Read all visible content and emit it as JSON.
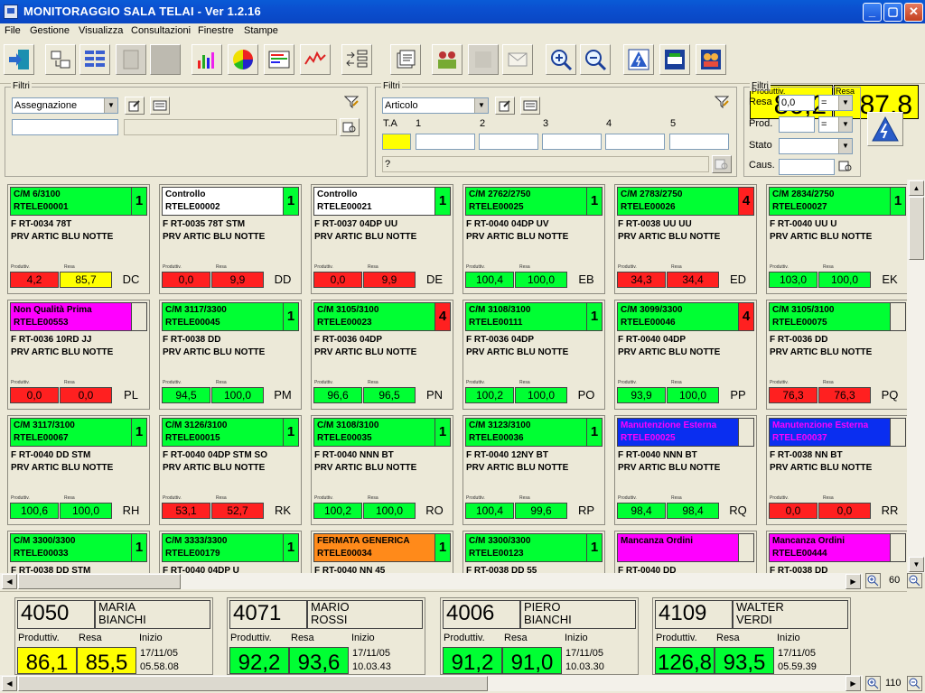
{
  "window": {
    "title": "MONITORAGGIO SALA TELAI - Ver 1.2.16",
    "min": "_",
    "max": "▢",
    "close": "✕"
  },
  "menu": [
    "File",
    "Gestione",
    "Visualizza",
    "Consultazioni",
    "Finestre",
    "Stampe"
  ],
  "kpis": {
    "produttiv_label": "Produttiv.",
    "produttiv_value": "86,2",
    "resa_label": "Resa",
    "resa_value": "87,8"
  },
  "filter1": {
    "label": "Filtri",
    "combo": "Assegnazione"
  },
  "filter2": {
    "label": "Filtri",
    "combo": "Articolo",
    "ta": "T.A",
    "cols": [
      "1",
      "2",
      "3",
      "4",
      "5"
    ],
    "query": "?"
  },
  "filter3": {
    "label": "Filtri",
    "resa_label": "Resa",
    "resa_value": "0,0",
    "resa_op": "=",
    "prod_label": "Prod.",
    "prod_op": "=",
    "stato_label": "Stato",
    "caus_label": "Caus."
  },
  "card_labels": {
    "produttiv": "Produttiv.",
    "resa": "Resa"
  },
  "cards": [
    {
      "h1": "C/M  6/3100",
      "h2": "RTELE00001",
      "num": "1",
      "color": "#00ff33",
      "numcolor": "#00ff33",
      "art": "F RT-0034 78T",
      "col": "PRV ARTIC BLU NOTTE",
      "prod": "4,2",
      "pcolor": "#ff2020",
      "resa": "85,7",
      "rcolor": "#ffff00",
      "code": "DC"
    },
    {
      "h1": "Controllo",
      "h2": "RTELE00002",
      "num": "1",
      "color": "#ffffff",
      "numcolor": "#00ff33",
      "art": "F RT-0035 78T STM",
      "col": "PRV ARTIC BLU NOTTE",
      "prod": "0,0",
      "pcolor": "#ff2020",
      "resa": "9,9",
      "rcolor": "#ff2020",
      "code": "DD"
    },
    {
      "h1": "Controllo",
      "h2": "RTELE00021",
      "num": "1",
      "color": "#ffffff",
      "numcolor": "#00ff33",
      "art": "F RT-0037 04DP UU",
      "col": "PRV ARTIC BLU NOTTE",
      "prod": "0,0",
      "pcolor": "#ff2020",
      "resa": "9,9",
      "rcolor": "#ff2020",
      "code": "DE"
    },
    {
      "h1": "C/M  2762/2750",
      "h2": "RTELE00025",
      "num": "1",
      "color": "#00ff33",
      "numcolor": "#00ff33",
      "art": "F RT-0040 04DP UV",
      "col": "PRV ARTIC BLU NOTTE",
      "prod": "100,4",
      "pcolor": "#00ff33",
      "resa": "100,0",
      "rcolor": "#00ff33",
      "code": "EB"
    },
    {
      "h1": "C/M  2783/2750",
      "h2": "RTELE00026",
      "num": "4",
      "color": "#00ff33",
      "numcolor": "#ff2020",
      "art": "F RT-0038 UU UU",
      "col": "PRV ARTIC BLU NOTTE",
      "prod": "34,3",
      "pcolor": "#ff2020",
      "resa": "34,4",
      "rcolor": "#ff2020",
      "code": "ED"
    },
    {
      "h1": "C/M  2834/2750",
      "h2": "RTELE00027",
      "num": "1",
      "color": "#00ff33",
      "numcolor": "#00ff33",
      "art": "F RT-0040 UU U",
      "col": "PRV ARTIC BLU NOTTE",
      "prod": "103,0",
      "pcolor": "#00ff33",
      "resa": "100,0",
      "rcolor": "#00ff33",
      "code": "EK"
    },
    {
      "h1": "Non Qualità Prima",
      "h2": "RTELE00553",
      "num": "",
      "color": "#ff00ff",
      "numcolor": "#ece9d8",
      "art": "F RT-0036 10RD JJ",
      "col": "PRV ARTIC BLU NOTTE",
      "prod": "0,0",
      "pcolor": "#ff2020",
      "resa": "0,0",
      "rcolor": "#ff2020",
      "code": "PL"
    },
    {
      "h1": "C/M  3117/3300",
      "h2": "RTELE00045",
      "num": "1",
      "color": "#00ff33",
      "numcolor": "#00ff33",
      "art": "F RT-0038 DD",
      "col": "PRV ARTIC BLU NOTTE",
      "prod": "94,5",
      "pcolor": "#00ff33",
      "resa": "100,0",
      "rcolor": "#00ff33",
      "code": "PM"
    },
    {
      "h1": "C/M  3105/3100",
      "h2": "RTELE00023",
      "num": "4",
      "color": "#00ff33",
      "numcolor": "#ff2020",
      "art": "F RT-0036 04DP",
      "col": "PRV ARTIC BLU NOTTE",
      "prod": "96,6",
      "pcolor": "#00ff33",
      "resa": "96,5",
      "rcolor": "#00ff33",
      "code": "PN"
    },
    {
      "h1": "C/M  3108/3100",
      "h2": "RTELE00111",
      "num": "1",
      "color": "#00ff33",
      "numcolor": "#00ff33",
      "art": "F RT-0036 04DP",
      "col": "PRV ARTIC BLU NOTTE",
      "prod": "100,2",
      "pcolor": "#00ff33",
      "resa": "100,0",
      "rcolor": "#00ff33",
      "code": "PO"
    },
    {
      "h1": "C/M  3099/3300",
      "h2": "RTELE00046",
      "num": "4",
      "color": "#00ff33",
      "numcolor": "#ff2020",
      "art": "F RT-0040 04DP",
      "col": "PRV ARTIC BLU NOTTE",
      "prod": "93,9",
      "pcolor": "#00ff33",
      "resa": "100,0",
      "rcolor": "#00ff33",
      "code": "PP"
    },
    {
      "h1": "C/M  3105/3100",
      "h2": "RTELE00075",
      "num": "",
      "color": "#00ff33",
      "numcolor": "#ece9d8",
      "art": "F RT-0036 DD",
      "col": "PRV ARTIC BLU NOTTE",
      "prod": "76,3",
      "pcolor": "#ff2020",
      "resa": "76,3",
      "rcolor": "#ff2020",
      "code": "PQ"
    },
    {
      "h1": "C/M  3117/3100",
      "h2": "RTELE00067",
      "num": "1",
      "color": "#00ff33",
      "numcolor": "#00ff33",
      "art": "F RT-0040 DD STM",
      "col": "PRV ARTIC BLU NOTTE",
      "prod": "100,6",
      "pcolor": "#00ff33",
      "resa": "100,0",
      "rcolor": "#00ff33",
      "code": "RH"
    },
    {
      "h1": "C/M  3126/3100",
      "h2": "RTELE00015",
      "num": "1",
      "color": "#00ff33",
      "numcolor": "#00ff33",
      "art": "F RT-0040 04DP STM SO",
      "col": "PRV ARTIC BLU NOTTE",
      "prod": "53,1",
      "pcolor": "#ff2020",
      "resa": "52,7",
      "rcolor": "#ff2020",
      "code": "RK"
    },
    {
      "h1": "C/M  3108/3100",
      "h2": "RTELE00035",
      "num": "1",
      "color": "#00ff33",
      "numcolor": "#00ff33",
      "art": "F RT-0040 NNN BT",
      "col": "PRV ARTIC BLU NOTTE",
      "prod": "100,2",
      "pcolor": "#00ff33",
      "resa": "100,0",
      "rcolor": "#00ff33",
      "code": "RO"
    },
    {
      "h1": "C/M  3123/3100",
      "h2": "RTELE00036",
      "num": "1",
      "color": "#00ff33",
      "numcolor": "#00ff33",
      "art": "F RT-0040 12NY BT",
      "col": "PRV ARTIC BLU NOTTE",
      "prod": "100,4",
      "pcolor": "#00ff33",
      "resa": "99,6",
      "rcolor": "#00ff33",
      "code": "RP"
    },
    {
      "h1": "Manutenzione Esterna",
      "h2": "RTELE00025",
      "num": "",
      "color": "#0a2ef0",
      "numcolor": "#ece9d8",
      "art": "F RT-0040 NNN BT",
      "col": "PRV ARTIC BLU NOTTE",
      "prod": "98,4",
      "pcolor": "#00ff33",
      "resa": "98,4",
      "rcolor": "#00ff33",
      "code": "RQ"
    },
    {
      "h1": "Manutenzione Esterna",
      "h2": "RTELE00037",
      "num": "",
      "color": "#0a2ef0",
      "numcolor": "#ece9d8",
      "art": "F RT-0038 NN BT",
      "col": "PRV ARTIC BLU NOTTE",
      "prod": "0,0",
      "pcolor": "#ff2020",
      "resa": "0,0",
      "rcolor": "#ff2020",
      "code": "RR"
    },
    {
      "h1": "C/M  3300/3300",
      "h2": "RTELE00033",
      "num": "1",
      "color": "#00ff33",
      "numcolor": "#00ff33",
      "art": "F RT-0038 DD STM",
      "col": "",
      "prod": "",
      "pcolor": "#00ff33",
      "resa": "",
      "rcolor": "#00ff33",
      "code": ""
    },
    {
      "h1": "C/M  3333/3300",
      "h2": "RTELE00179",
      "num": "1",
      "color": "#00ff33",
      "numcolor": "#00ff33",
      "art": "F RT-0040 04DP U",
      "col": "",
      "prod": "",
      "pcolor": "#00ff33",
      "resa": "",
      "rcolor": "#00ff33",
      "code": ""
    },
    {
      "h1": "FERMATA GENERICA",
      "h2": "RTELE00034",
      "num": "1",
      "color": "#ff8a1a",
      "numcolor": "#00ff33",
      "art": "F RT-0040 NN 45",
      "col": "",
      "prod": "",
      "pcolor": "#00ff33",
      "resa": "",
      "rcolor": "#00ff33",
      "code": ""
    },
    {
      "h1": "C/M  3300/3300",
      "h2": "RTELE00123",
      "num": "1",
      "color": "#00ff33",
      "numcolor": "#00ff33",
      "art": "F RT-0038 DD 55",
      "col": "",
      "prod": "",
      "pcolor": "#00ff33",
      "resa": "",
      "rcolor": "#00ff33",
      "code": ""
    },
    {
      "h1": "Mancanza Ordini",
      "h2": "",
      "num": "",
      "color": "#ff00ff",
      "numcolor": "#ece9d8",
      "art": "F RT-0040 DD",
      "col": "",
      "prod": "",
      "pcolor": "#00ff33",
      "resa": "",
      "rcolor": "#00ff33",
      "code": ""
    },
    {
      "h1": "Mancanza Ordini",
      "h2": "RTELE00444",
      "num": "",
      "color": "#ff00ff",
      "numcolor": "#ece9d8",
      "art": "F RT-0038 DD",
      "col": "",
      "prod": "",
      "pcolor": "#00ff33",
      "resa": "",
      "rcolor": "#00ff33",
      "code": ""
    }
  ],
  "zoom_top": "60",
  "zoom_bottom": "110",
  "operator_labels": {
    "produttiv": "Produttiv.",
    "resa": "Resa",
    "inizio": "Inizio"
  },
  "operators": [
    {
      "id": "4050",
      "first": "MARIA",
      "last": "BIANCHI",
      "prod": "86,1",
      "pcolor": "#ffff00",
      "resa": "85,5",
      "rcolor": "#ffff00",
      "date": "17/11/05",
      "time": "05.58.08"
    },
    {
      "id": "4071",
      "first": "MARIO",
      "last": "ROSSI",
      "prod": "92,2",
      "pcolor": "#00ff33",
      "resa": "93,6",
      "rcolor": "#00ff33",
      "date": "17/11/05",
      "time": "10.03.43"
    },
    {
      "id": "4006",
      "first": "PIERO",
      "last": "BIANCHI",
      "prod": "91,2",
      "pcolor": "#00ff33",
      "resa": "91,0",
      "rcolor": "#00ff33",
      "date": "17/11/05",
      "time": "10.03.30"
    },
    {
      "id": "4109",
      "first": "WALTER",
      "last": "VERDI",
      "prod": "126,8",
      "pcolor": "#00ff33",
      "resa": "93,5",
      "rcolor": "#00ff33",
      "date": "17/11/05",
      "time": "05.59.39"
    }
  ]
}
